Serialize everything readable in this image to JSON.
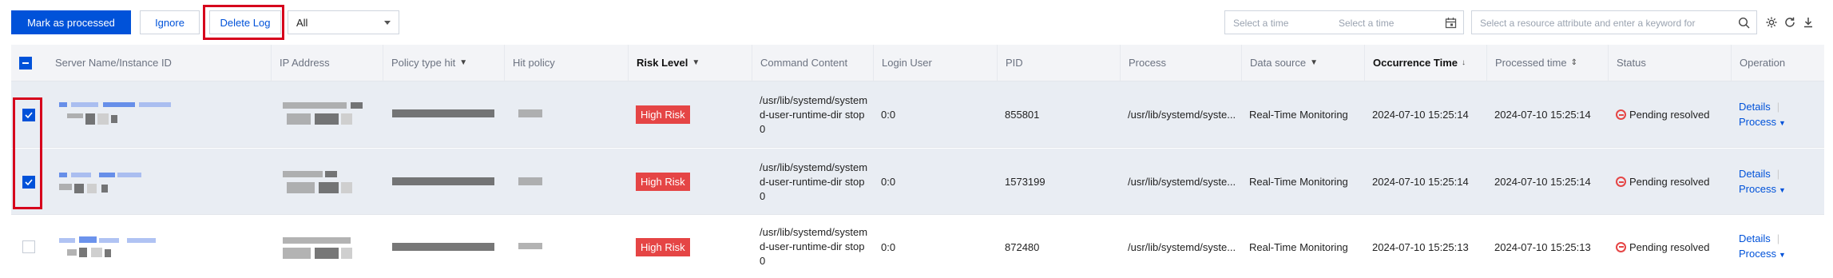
{
  "toolbar": {
    "mark_processed_label": "Mark as processed",
    "ignore_label": "Ignore",
    "delete_log_label": "Delete Log",
    "filter_select_value": "All",
    "date_start_placeholder": "Select a time",
    "date_end_placeholder": "Select a time",
    "search_placeholder": "Select a resource attribute and enter a keyword for"
  },
  "table": {
    "columns": {
      "server": "Server Name/Instance ID",
      "ip": "IP Address",
      "policy_type": "Policy type hit",
      "hit_policy": "Hit policy",
      "risk_level": "Risk Level",
      "command": "Command Content",
      "login_user": "Login User",
      "pid": "PID",
      "process": "Process",
      "data_source": "Data source",
      "occurrence_time": "Occurrence Time",
      "processed_time": "Processed time",
      "status": "Status",
      "operation": "Operation"
    },
    "rows": [
      {
        "checked": true,
        "risk": "High Risk",
        "command": "/usr/lib/systemd/systemd-user-runtime-dir stop 0",
        "login_user": "0:0",
        "pid": "855801",
        "process": "/usr/lib/systemd/syste...",
        "data_source": "Real-Time Monitoring",
        "occurrence_time": "2024-07-10 15:25:14",
        "processed_time": "2024-07-10 15:25:14",
        "status": "Pending resolved",
        "op_details": "Details",
        "op_process": "Process"
      },
      {
        "checked": true,
        "risk": "High Risk",
        "command": "/usr/lib/systemd/systemd-user-runtime-dir stop 0",
        "login_user": "0:0",
        "pid": "1573199",
        "process": "/usr/lib/systemd/syste...",
        "data_source": "Real-Time Monitoring",
        "occurrence_time": "2024-07-10 15:25:14",
        "processed_time": "2024-07-10 15:25:14",
        "status": "Pending resolved",
        "op_details": "Details",
        "op_process": "Process"
      },
      {
        "checked": false,
        "risk": "High Risk",
        "command": "/usr/lib/systemd/systemd-user-runtime-dir stop 0",
        "login_user": "0:0",
        "pid": "872480",
        "process": "/usr/lib/systemd/syste...",
        "data_source": "Real-Time Monitoring",
        "occurrence_time": "2024-07-10 15:25:13",
        "processed_time": "2024-07-10 15:25:13",
        "status": "Pending resolved",
        "op_details": "Details",
        "op_process": "Process"
      }
    ]
  },
  "colors": {
    "primary": "#0052d9",
    "danger": "#e54545",
    "highlight": "#d6001c"
  },
  "icons": [
    "calendar-icon",
    "search-icon",
    "settings-icon",
    "refresh-icon",
    "download-icon",
    "filter-icon",
    "sort-icon",
    "pending-icon",
    "caret-down-icon"
  ]
}
